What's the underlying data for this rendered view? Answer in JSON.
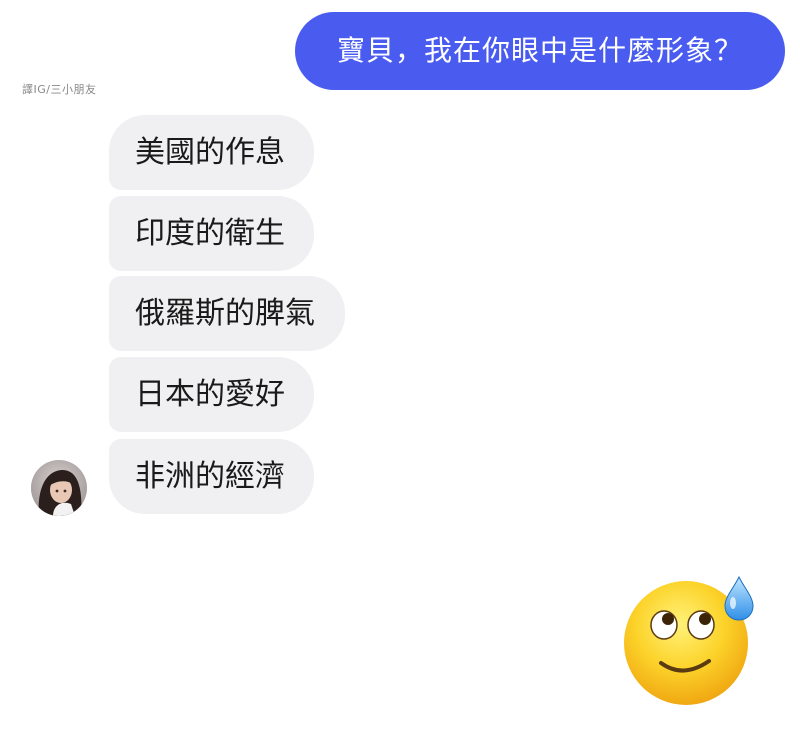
{
  "outgoing_message": {
    "text": "寶貝，我在你眼中是什麼形象？"
  },
  "watermark": {
    "text": "譯IG/三小朋友"
  },
  "incoming_messages": [
    {
      "text": "美國的作息"
    },
    {
      "text": "印度的衛生"
    },
    {
      "text": "俄羅斯的脾氣"
    },
    {
      "text": "日本的愛好"
    },
    {
      "text": "非洲的經濟"
    }
  ],
  "reaction_emoji": {
    "icon": "sweat-smile-eyes-up-emoji"
  },
  "colors": {
    "outgoing_bubble": "#4a5cf0",
    "incoming_bubble": "#f0f0f2",
    "background": "#ffffff"
  }
}
